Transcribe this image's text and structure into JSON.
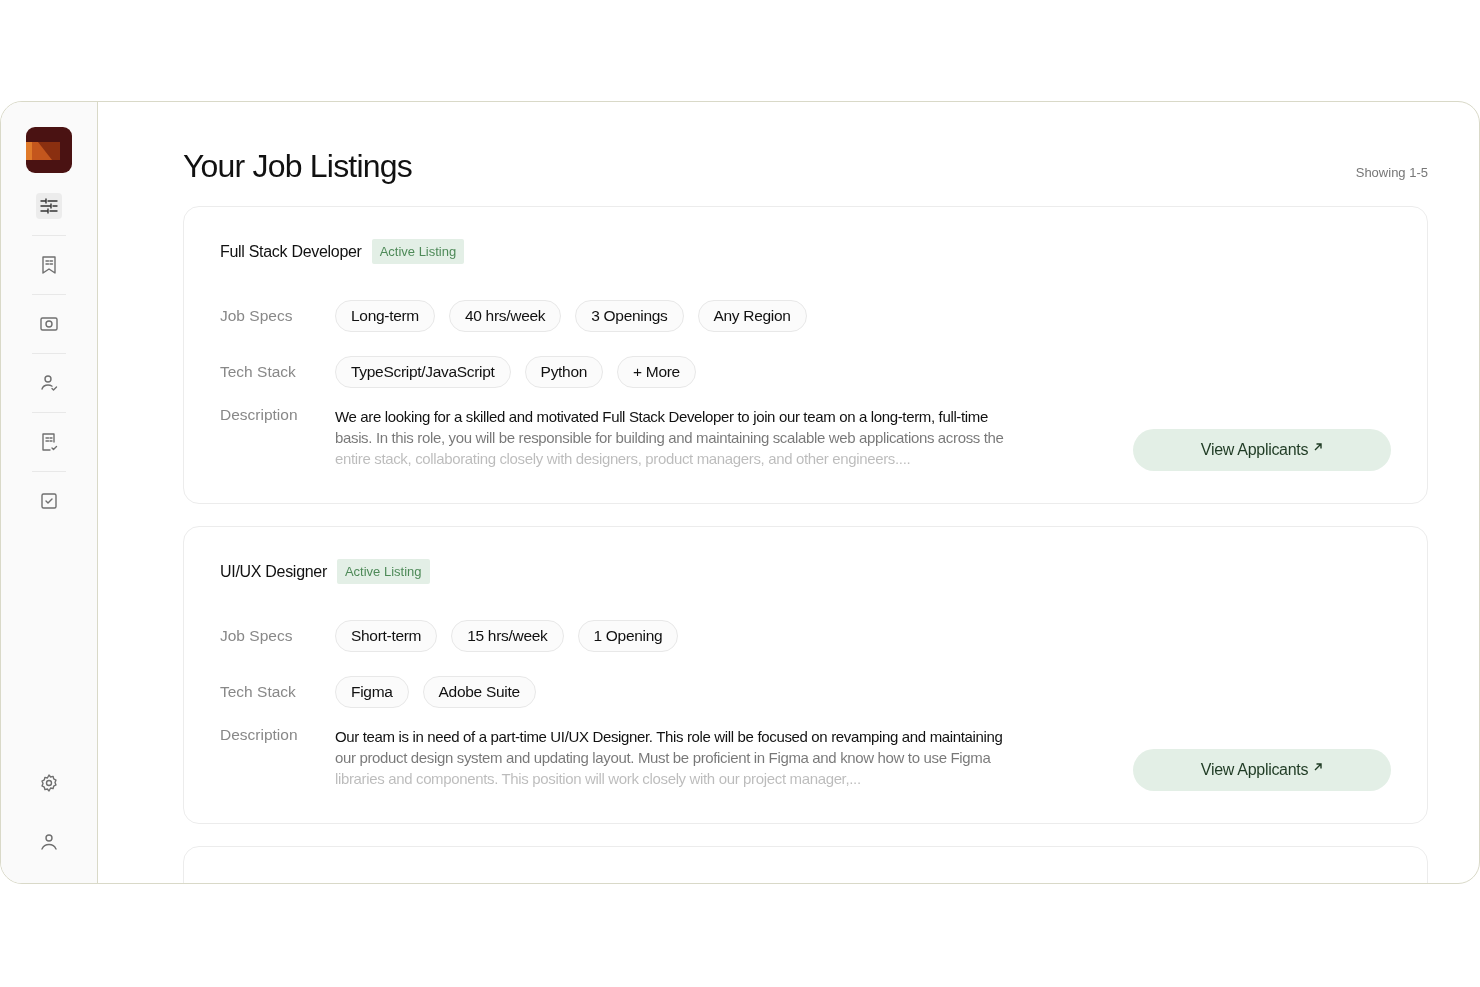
{
  "sidebar": {
    "items": [
      {
        "kind": "sliders",
        "selected": true
      },
      {
        "kind": "bookmark",
        "selected": false
      },
      {
        "kind": "camera",
        "selected": false
      },
      {
        "kind": "user-check",
        "selected": false
      },
      {
        "kind": "doc-check",
        "selected": false
      },
      {
        "kind": "checkbox",
        "selected": false
      }
    ],
    "bottom_items": [
      {
        "kind": "settings"
      },
      {
        "kind": "profile"
      }
    ]
  },
  "header": {
    "title": "Your Job Listings",
    "count": "Showing 1-5"
  },
  "listings": [
    {
      "title": "Full Stack Developer",
      "status": "Active Listing",
      "specs_label": "Job Specs",
      "specs": [
        "Long-term",
        "40 hrs/week",
        "3 Openings",
        "Any Region"
      ],
      "stack_label": "Tech Stack",
      "stack": [
        "TypeScript/JavaScript",
        "Python",
        "+ More"
      ],
      "description_label": "Description",
      "description": "We are looking for a skilled and motivated Full Stack Developer to join our team on a long-term, full-time basis. In this role, you will be responsible for building and maintaining scalable web applications across the entire stack, collaborating closely with designers, product managers, and other engineers....",
      "button": "View Applicants"
    },
    {
      "title": "UI/UX Designer",
      "status": "Active Listing",
      "specs_label": "Job Specs",
      "specs": [
        "Short-term",
        "15 hrs/week",
        "1 Opening"
      ],
      "stack_label": "Tech Stack",
      "stack": [
        "Figma",
        "Adobe Suite"
      ],
      "description_label": "Description",
      "description": "Our team is in need of a part-time UI/UX Designer. This role will be focused on revamping and maintaining our product design system and updating layout. Must be proficient in Figma and know how to use Figma libraries and components. This position will work closely with our project manager,...",
      "button": "View Applicants"
    }
  ]
}
